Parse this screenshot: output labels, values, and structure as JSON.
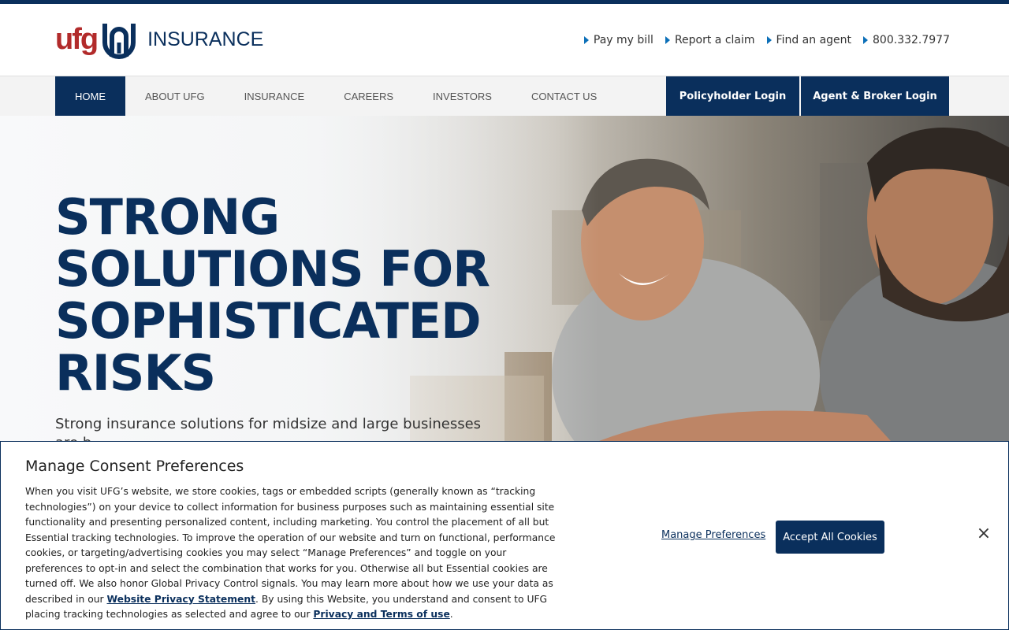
{
  "header": {
    "logo_text": "ufg",
    "logo_suffix": "INSURANCE",
    "utility_links": [
      {
        "label": "Pay my bill"
      },
      {
        "label": "Report a claim"
      },
      {
        "label": "Find an agent"
      },
      {
        "label": "800.332.7977"
      }
    ]
  },
  "nav": {
    "items": [
      {
        "label": "HOME",
        "active": true
      },
      {
        "label": "ABOUT UFG"
      },
      {
        "label": "INSURANCE"
      },
      {
        "label": "CAREERS"
      },
      {
        "label": "INVESTORS"
      },
      {
        "label": "CONTACT US"
      }
    ],
    "policyholder_login": "Policyholder Login",
    "agent_login": "Agent & Broker Login"
  },
  "hero": {
    "title": "STRONG SOLUTIONS FOR SOPHISTICATED RISKS",
    "subtitle": "Strong insurance solutions for midsize and large businesses are b..."
  },
  "consent": {
    "title": "Manage Consent Preferences",
    "body_1": "When you visit UFG’s website, we store cookies, tags or embedded scripts (generally known as “tracking technologies”) on your device to collect information for business purposes such as maintaining essential site functionality and presenting personalized content, including marketing. You control the placement of all but Essential tracking technologies. To improve the operation of our website and turn on functional, performance cookies, or targeting/advertising cookies you may select “Manage Preferences” and toggle on your preferences to opt-in and select the combination that works for you. Otherwise all but Essential cookies are turned off. We also honor Global Privacy Control signals. You may learn more about how we use your data as described in our ",
    "privacy_link": "Website Privacy Statement",
    "body_2": ". By using this Website, you understand and consent to UFG placing tracking technologies as selected and agree to our ",
    "terms_link": "Privacy and Terms of use",
    "body_3": ".",
    "manage_label": "Manage Preferences",
    "accept_label": "Accept All Cookies",
    "close_glyph": "×"
  },
  "colors": {
    "brand_navy": "#0a2f5c",
    "brand_red": "#b22b2b",
    "link_arrow": "#0b6fb8"
  },
  "icons": [
    "ufg-logo-mark",
    "triangle-arrow-icon",
    "close-icon"
  ]
}
